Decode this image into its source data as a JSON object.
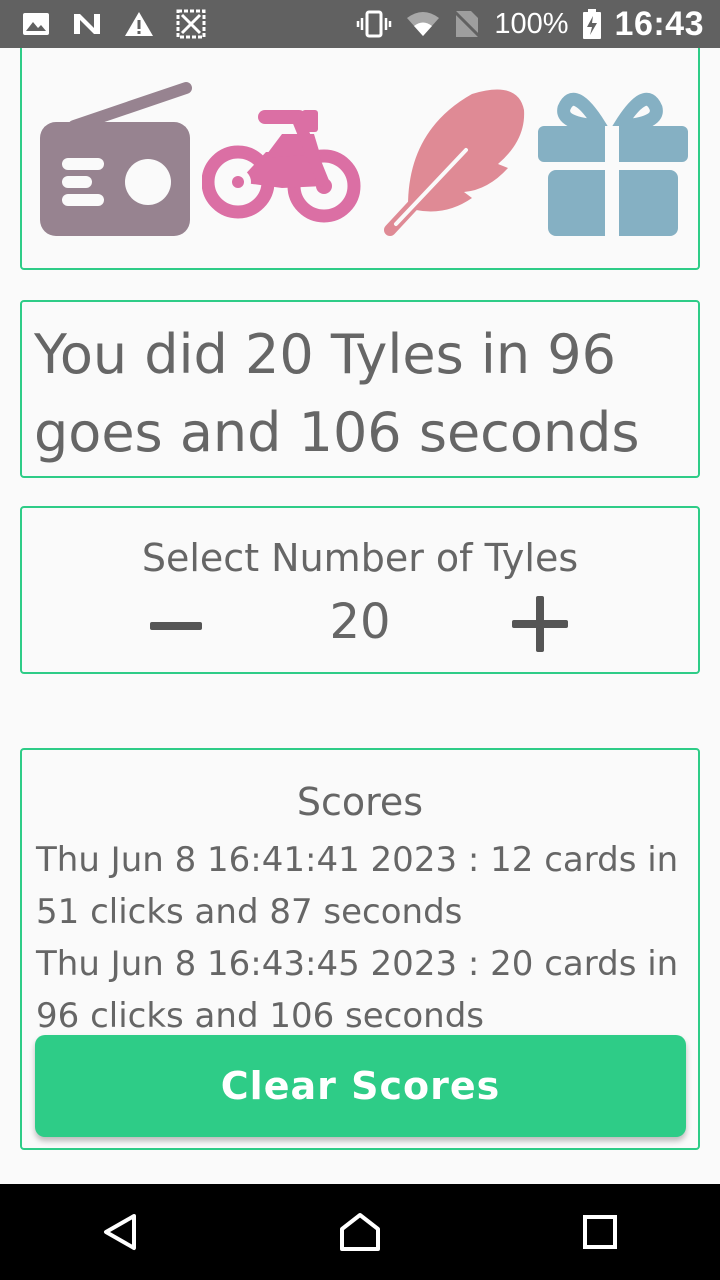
{
  "status_bar": {
    "battery_percent": "100%",
    "time": "16:43"
  },
  "icons": [
    "radio-icon",
    "motorcycle-icon",
    "feather-icon",
    "gift-icon"
  ],
  "colors": {
    "accent": "#2ecc87",
    "radio": "#978390",
    "motorcycle": "#db6fa4",
    "feather": "#df8a95",
    "gift": "#85b0c3"
  },
  "result": {
    "text": "You did 20 Tyles in 96 goes and 106 seconds"
  },
  "selector": {
    "label": "Select Number of Tyles",
    "value": "20"
  },
  "scores": {
    "title": "Scores",
    "entries": [
      "Thu Jun  8 16:41:41 2023 : 12 cards in 51 clicks and 87 seconds",
      "Thu Jun  8 16:43:45 2023 : 20 cards in 96 clicks and 106 seconds"
    ]
  },
  "clear_button": {
    "label": "Clear Scores"
  }
}
